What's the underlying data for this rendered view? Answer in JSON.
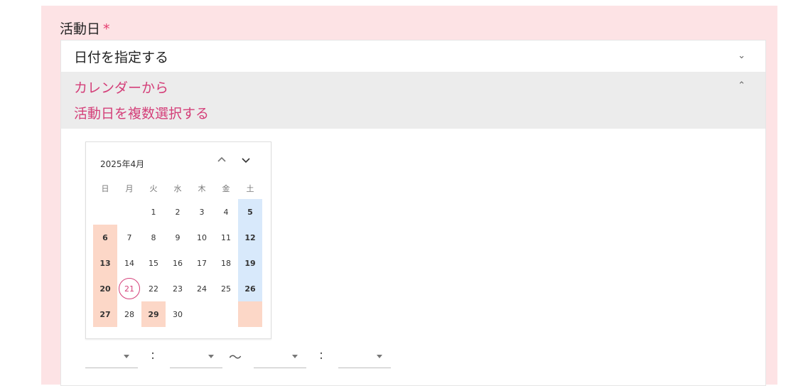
{
  "form": {
    "label": "活動日",
    "required_mark": "*"
  },
  "options": [
    {
      "label": "日付を指定する",
      "expanded": false
    },
    {
      "label_line1": "カレンダーから",
      "label_line2": "活動日を複数選択する",
      "expanded": true
    }
  ],
  "calendar": {
    "title": "2025年4月",
    "weekdays": [
      "日",
      "月",
      "火",
      "水",
      "木",
      "金",
      "土"
    ],
    "weeks": [
      [
        "",
        "",
        "1",
        "2",
        "3",
        "4",
        "5"
      ],
      [
        "6",
        "7",
        "8",
        "9",
        "10",
        "11",
        "12"
      ],
      [
        "13",
        "14",
        "15",
        "16",
        "17",
        "18",
        "19"
      ],
      [
        "20",
        "21",
        "22",
        "23",
        "24",
        "25",
        "26"
      ],
      [
        "27",
        "28",
        "29",
        "30",
        "",
        "",
        ""
      ]
    ],
    "today": "21",
    "highlighted_holiday": "29"
  },
  "time_range": {
    "colon": ":",
    "tilde": "〜"
  },
  "colors": {
    "accent": "#d43f79",
    "sunday_bg": "#fcd7c7",
    "saturday_bg": "#d8e9fb",
    "page_bg": "#fde3e5"
  },
  "icons": {
    "collapse": "chevron-down-icon",
    "expand": "chevron-up-icon",
    "dropdown": "caret-down-icon"
  }
}
